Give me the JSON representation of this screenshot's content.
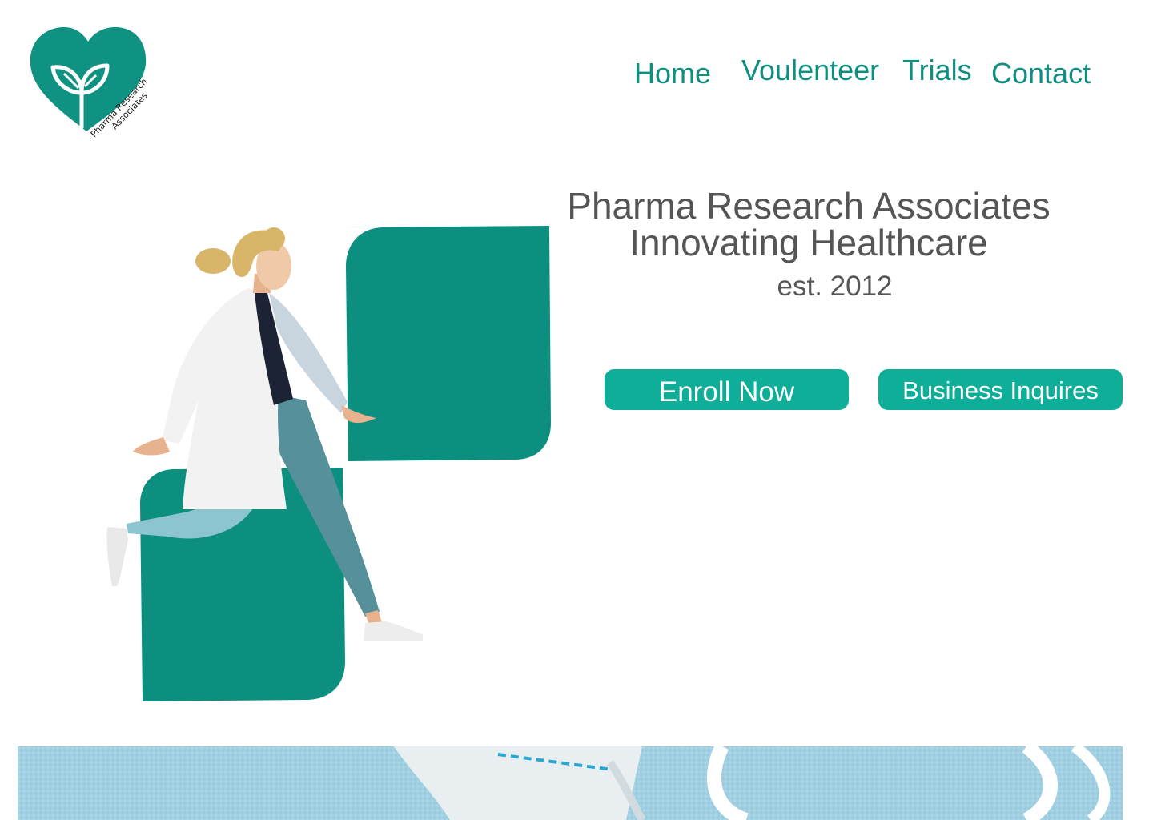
{
  "logo": {
    "icon": "heart-sprout-icon",
    "line1": "Pharma Research",
    "line2": "Associates",
    "color": "#0f9281"
  },
  "nav": {
    "home": "Home",
    "volunteer": "Voulenteer",
    "trials": "Trials",
    "contact": "Contact",
    "color": "#0f8f80"
  },
  "hero": {
    "title_line1": "Pharma Research Associates",
    "title_line2": "Innovating Healthcare",
    "established": "est. 2012",
    "text_color": "#555555"
  },
  "buttons": {
    "enroll": "Enroll Now",
    "business": "Business Inquires",
    "color": "#0fae99"
  },
  "illustration": {
    "subject": "doctor-in-lab-coat-illustration",
    "block_color": "#0c8f7f"
  },
  "photo": {
    "subject": "surgical-face-mask-photo",
    "color": "#9fcfe0"
  }
}
